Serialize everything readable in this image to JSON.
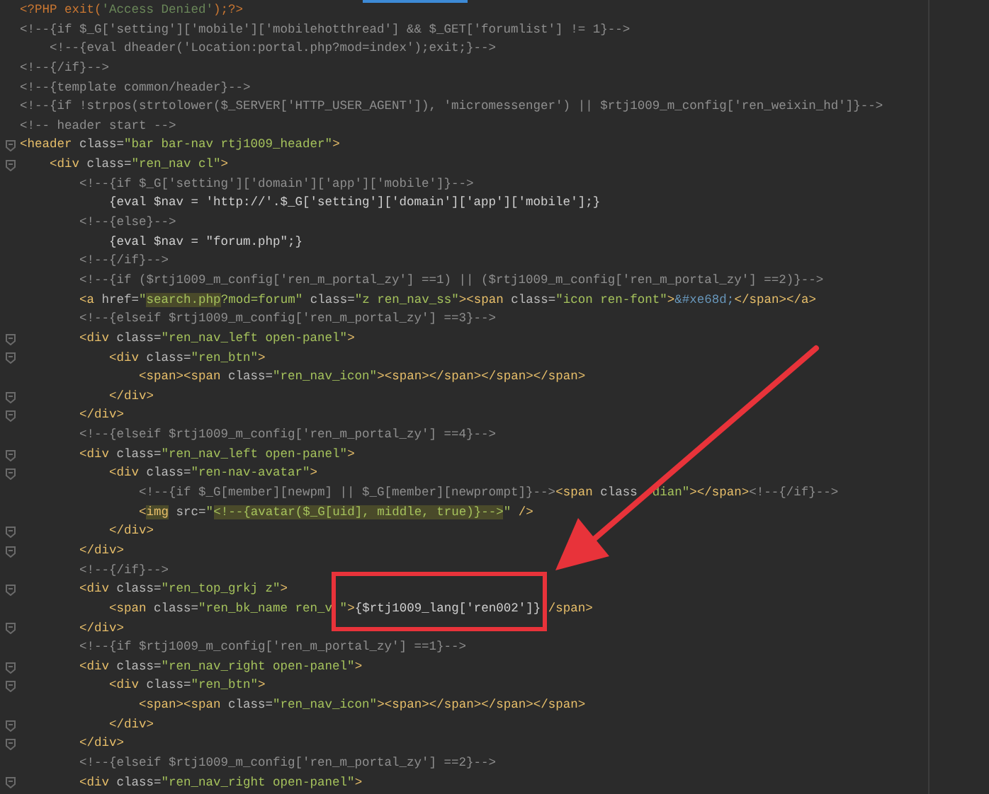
{
  "editor": {
    "lines": [
      {
        "fold": false,
        "segments": [
          {
            "kind": "keyword",
            "text": "<?PHP exit("
          },
          {
            "kind": "phpstring",
            "text": "'Access Denied'"
          },
          {
            "kind": "keyword",
            "text": ");?>"
          }
        ]
      },
      {
        "fold": false,
        "segments": [
          {
            "kind": "comment",
            "text": "<!--{if $_G['setting']['mobile']['mobilehotthread'] && $_GET['forumlist'] != 1}-->"
          }
        ]
      },
      {
        "fold": false,
        "segments": [
          {
            "kind": "comment",
            "text": "    <!--{eval dheader('Location:portal.php?mod=index');exit;}-->"
          }
        ]
      },
      {
        "fold": false,
        "segments": [
          {
            "kind": "comment",
            "text": "<!--{/if}-->"
          }
        ]
      },
      {
        "fold": false,
        "segments": [
          {
            "kind": "comment",
            "text": "<!--{template common/header}-->"
          }
        ]
      },
      {
        "fold": false,
        "segments": [
          {
            "kind": "comment",
            "text": "<!--{if !strpos(strtolower($_SERVER['HTTP_USER_AGENT']), 'micromessenger') || $rtj1009_m_config['ren_weixin_hd']}-->"
          }
        ]
      },
      {
        "fold": false,
        "segments": [
          {
            "kind": "comment",
            "text": "<!-- header start -->"
          }
        ]
      },
      {
        "fold": true,
        "segments": [
          {
            "kind": "tag",
            "text": "<header"
          },
          {
            "kind": "attr",
            "text": " class="
          },
          {
            "kind": "string",
            "text": "\"bar bar-nav rtj1009_header\""
          },
          {
            "kind": "tag",
            "text": ">"
          }
        ]
      },
      {
        "fold": true,
        "segments": [
          {
            "kind": "tag",
            "text": "    <div"
          },
          {
            "kind": "attr",
            "text": " class="
          },
          {
            "kind": "string",
            "text": "\"ren_nav cl\""
          },
          {
            "kind": "tag",
            "text": ">"
          }
        ]
      },
      {
        "fold": false,
        "segments": [
          {
            "kind": "comment",
            "text": "        <!--{if $_G['setting']['domain']['app']['mobile']}-->"
          }
        ]
      },
      {
        "fold": false,
        "segments": [
          {
            "kind": "text",
            "text": "            {eval $nav = 'http://'.$_G['setting']['domain']['app']['mobile'];}"
          }
        ]
      },
      {
        "fold": false,
        "segments": [
          {
            "kind": "comment",
            "text": "        <!--{else}-->"
          }
        ]
      },
      {
        "fold": false,
        "segments": [
          {
            "kind": "text",
            "text": "            {eval $nav = \"forum.php\";}"
          }
        ]
      },
      {
        "fold": false,
        "segments": [
          {
            "kind": "comment",
            "text": "        <!--{/if}-->"
          }
        ]
      },
      {
        "fold": false,
        "segments": [
          {
            "kind": "comment",
            "text": "        <!--{if ($rtj1009_m_config['ren_m_portal_zy'] ==1) || ($rtj1009_m_config['ren_m_portal_zy'] ==2)}-->"
          }
        ]
      },
      {
        "fold": false,
        "segments": [
          {
            "kind": "tag",
            "text": "        <a"
          },
          {
            "kind": "attr",
            "text": " href="
          },
          {
            "kind": "string",
            "text": "\""
          },
          {
            "kind": "match_string",
            "text": "search.php"
          },
          {
            "kind": "string",
            "text": "?mod=forum\""
          },
          {
            "kind": "attr",
            "text": " class="
          },
          {
            "kind": "string",
            "text": "\"z ren_nav_ss\""
          },
          {
            "kind": "tag",
            "text": "><span"
          },
          {
            "kind": "attr",
            "text": " class="
          },
          {
            "kind": "string",
            "text": "\"icon ren-font\""
          },
          {
            "kind": "tag",
            "text": ">"
          },
          {
            "kind": "entity",
            "text": "&#xe68d;"
          },
          {
            "kind": "tag",
            "text": "</span></a>"
          }
        ]
      },
      {
        "fold": false,
        "segments": [
          {
            "kind": "comment",
            "text": "        <!--{elseif $rtj1009_m_config['ren_m_portal_zy'] ==3}-->"
          }
        ]
      },
      {
        "fold": true,
        "segments": [
          {
            "kind": "tag",
            "text": "        <div"
          },
          {
            "kind": "attr",
            "text": " class="
          },
          {
            "kind": "string",
            "text": "\"ren_nav_left open-panel\""
          },
          {
            "kind": "tag",
            "text": ">"
          }
        ]
      },
      {
        "fold": true,
        "segments": [
          {
            "kind": "tag",
            "text": "            <div"
          },
          {
            "kind": "attr",
            "text": " class="
          },
          {
            "kind": "string",
            "text": "\"ren_btn\""
          },
          {
            "kind": "tag",
            "text": ">"
          }
        ]
      },
      {
        "fold": false,
        "segments": [
          {
            "kind": "tag",
            "text": "                <span><span"
          },
          {
            "kind": "attr",
            "text": " class="
          },
          {
            "kind": "string",
            "text": "\"ren_nav_icon\""
          },
          {
            "kind": "tag",
            "text": "><span></span></span></span>"
          }
        ]
      },
      {
        "fold": true,
        "segments": [
          {
            "kind": "tag",
            "text": "            </div>"
          }
        ]
      },
      {
        "fold": true,
        "segments": [
          {
            "kind": "tag",
            "text": "        </div>"
          }
        ]
      },
      {
        "fold": false,
        "segments": [
          {
            "kind": "comment",
            "text": "        <!--{elseif $rtj1009_m_config['ren_m_portal_zy'] ==4}-->"
          }
        ]
      },
      {
        "fold": true,
        "segments": [
          {
            "kind": "tag",
            "text": "        <div"
          },
          {
            "kind": "attr",
            "text": " class="
          },
          {
            "kind": "string",
            "text": "\"ren_nav_left open-panel\""
          },
          {
            "kind": "tag",
            "text": ">"
          }
        ]
      },
      {
        "fold": true,
        "segments": [
          {
            "kind": "tag",
            "text": "            <div"
          },
          {
            "kind": "attr",
            "text": " class="
          },
          {
            "kind": "string",
            "text": "\"ren-nav-avatar\""
          },
          {
            "kind": "tag",
            "text": ">"
          }
        ]
      },
      {
        "fold": false,
        "segments": [
          {
            "kind": "comment",
            "text": "                <!--{if $_G[member][newpm] || $_G[member][newprompt]}-->"
          },
          {
            "kind": "tag",
            "text": "<span"
          },
          {
            "kind": "attr",
            "text": " class"
          },
          {
            "kind": "gap"
          },
          {
            "kind": "gap"
          },
          {
            "kind": "string",
            "text": "dian\""
          },
          {
            "kind": "tag",
            "text": "></span>"
          },
          {
            "kind": "comment",
            "text": "<!--{/if}-->"
          }
        ]
      },
      {
        "fold": false,
        "segments": [
          {
            "kind": "tag",
            "text": "                <"
          },
          {
            "kind": "match_tag",
            "text": "img"
          },
          {
            "kind": "attr",
            "text": " src="
          },
          {
            "kind": "string",
            "text": "\""
          },
          {
            "kind": "match_string",
            "text": "<!--{avatar($_G[uid], middle, true)}-->"
          },
          {
            "kind": "string",
            "text": "\""
          },
          {
            "kind": "tag",
            "text": " />"
          }
        ]
      },
      {
        "fold": true,
        "segments": [
          {
            "kind": "tag",
            "text": "            </div>"
          }
        ]
      },
      {
        "fold": true,
        "segments": [
          {
            "kind": "tag",
            "text": "        </div>"
          }
        ]
      },
      {
        "fold": false,
        "segments": [
          {
            "kind": "comment",
            "text": "        <!--{/if}-->"
          }
        ]
      },
      {
        "fold": true,
        "segments": [
          {
            "kind": "tag",
            "text": "        <div"
          },
          {
            "kind": "attr",
            "text": " class="
          },
          {
            "kind": "string",
            "text": "\"ren_top_grkj z\""
          },
          {
            "kind": "tag",
            "text": ">"
          }
        ]
      },
      {
        "fold": false,
        "segments": [
          {
            "kind": "tag",
            "text": "            <span"
          },
          {
            "kind": "attr",
            "text": " class="
          },
          {
            "kind": "string",
            "text": "\"ren_bk_name ren_v"
          },
          {
            "kind": "gap"
          },
          {
            "kind": "string",
            "text": "\""
          },
          {
            "kind": "tag",
            "text": ">"
          },
          {
            "kind": "text",
            "text": "{$rtj1009_lang['ren002']}"
          },
          {
            "kind": "gap"
          },
          {
            "kind": "tag",
            "text": "/span>"
          }
        ]
      },
      {
        "fold": true,
        "segments": [
          {
            "kind": "tag",
            "text": "        </div>"
          }
        ]
      },
      {
        "fold": false,
        "segments": [
          {
            "kind": "comment",
            "text": "        <!--{if $rtj1009_m_config['ren_m_portal_zy'] ==1}-->"
          }
        ]
      },
      {
        "fold": true,
        "segments": [
          {
            "kind": "tag",
            "text": "        <div"
          },
          {
            "kind": "attr",
            "text": " class="
          },
          {
            "kind": "string",
            "text": "\"ren_nav_right open-panel\""
          },
          {
            "kind": "tag",
            "text": ">"
          }
        ]
      },
      {
        "fold": true,
        "segments": [
          {
            "kind": "tag",
            "text": "            <div"
          },
          {
            "kind": "attr",
            "text": " class="
          },
          {
            "kind": "string",
            "text": "\"ren_btn\""
          },
          {
            "kind": "tag",
            "text": ">"
          }
        ]
      },
      {
        "fold": false,
        "segments": [
          {
            "kind": "tag",
            "text": "                <span><span"
          },
          {
            "kind": "attr",
            "text": " class="
          },
          {
            "kind": "string",
            "text": "\"ren_nav_icon\""
          },
          {
            "kind": "tag",
            "text": "><span></span></span></span>"
          }
        ]
      },
      {
        "fold": true,
        "segments": [
          {
            "kind": "tag",
            "text": "            </div>"
          }
        ]
      },
      {
        "fold": true,
        "segments": [
          {
            "kind": "tag",
            "text": "        </div>"
          }
        ]
      },
      {
        "fold": false,
        "segments": [
          {
            "kind": "comment",
            "text": "        <!--{elseif $rtj1009_m_config['ren_m_portal_zy'] ==2}-->"
          }
        ]
      },
      {
        "fold": true,
        "segments": [
          {
            "kind": "tag",
            "text": "        <div"
          },
          {
            "kind": "attr",
            "text": " class="
          },
          {
            "kind": "string",
            "text": "\"ren_nav_right open-panel\""
          },
          {
            "kind": "tag",
            "text": ">"
          }
        ]
      }
    ]
  }
}
